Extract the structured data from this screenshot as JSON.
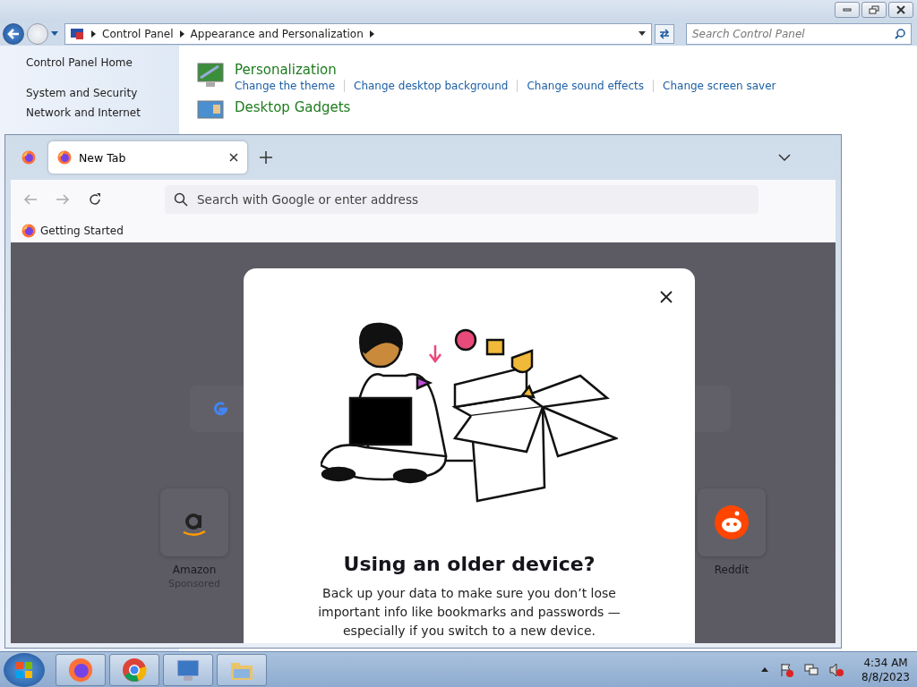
{
  "explorer": {
    "breadcrumb": [
      "Control Panel",
      "Appearance and Personalization"
    ],
    "search": {
      "placeholder": "Search Control Panel"
    },
    "sidebar": [
      {
        "label": "Control Panel Home"
      },
      {
        "label": "System and Security"
      },
      {
        "label": "Network and Internet"
      }
    ],
    "categories": [
      {
        "kind": "personalization",
        "title": "Personalization",
        "links": [
          "Change the theme",
          "Change desktop background",
          "Change sound effects",
          "Change screen saver"
        ]
      },
      {
        "kind": "gadgets",
        "title": "Desktop Gadgets"
      }
    ]
  },
  "browser": {
    "tabs": [
      {
        "label": "New Tab",
        "selected": true
      }
    ],
    "address": {
      "placeholder": "Search with Google or enter address"
    },
    "bookmarks": [
      {
        "label": "Getting Started"
      }
    ],
    "shortcuts": [
      {
        "kind": "amazon",
        "name": "Amazon",
        "note": "Sponsored"
      },
      {
        "kind": "reddit",
        "name": "Reddit"
      }
    ],
    "dialog": {
      "title": "Using an older device?",
      "body": "Back up your data to make sure you don’t lose important info like bookmarks and passwords — especially if you switch to a new device."
    }
  },
  "taskbar": {
    "apps": [
      {
        "kind": "firefox"
      },
      {
        "kind": "chrome"
      },
      {
        "kind": "control-panel"
      },
      {
        "kind": "explorer"
      }
    ],
    "time": "4:34 AM",
    "date": "8/8/2023"
  }
}
